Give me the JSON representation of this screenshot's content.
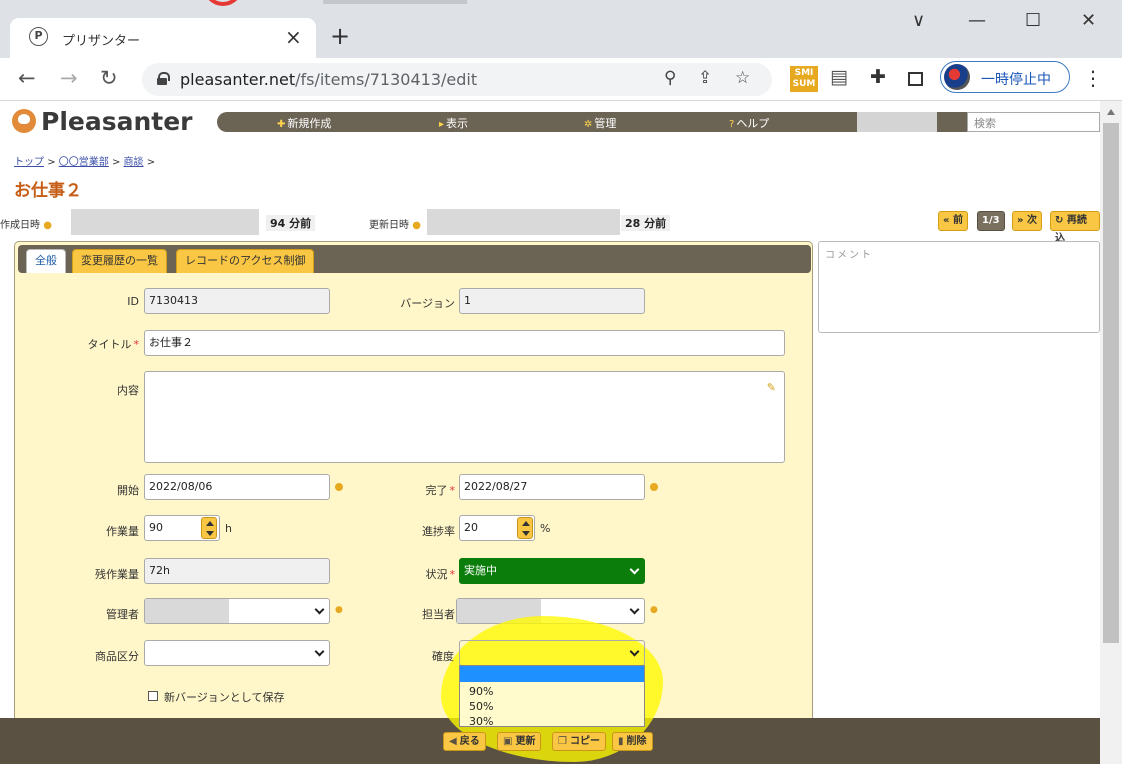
{
  "browser": {
    "tab_title": "プリザンター",
    "tab_favicon": "P",
    "url_host": "pleasanter.net",
    "url_path": "/fs/items/7130413/edit",
    "profile_label": "一時停止中",
    "ext_smi": "SMI\nSUM"
  },
  "app": {
    "logo": "Pleasanter",
    "menu": {
      "new": "新規作成",
      "view": "表示",
      "manage": "管理",
      "help": "ヘルプ"
    },
    "search_placeholder": "検索"
  },
  "breadcrumb": {
    "top": "トップ",
    "dept": "〇〇営業部",
    "category": "商談",
    "sep": ">"
  },
  "record": {
    "title": "お仕事２",
    "created_label": "作成日時",
    "created_ago": "94 分前",
    "updated_label": "更新日時",
    "updated_ago": "28 分前"
  },
  "pager": {
    "prev": "前",
    "position": "1/3",
    "next": "次",
    "reload": "再読込"
  },
  "tabs": [
    "全般",
    "変更履歴の一覧",
    "レコードのアクセス制御"
  ],
  "fields": {
    "id": {
      "label": "ID",
      "value": "7130413"
    },
    "version": {
      "label": "バージョン",
      "value": "1"
    },
    "title": {
      "label": "タイトル",
      "value": "お仕事２"
    },
    "body": {
      "label": "内容",
      "value": ""
    },
    "start": {
      "label": "開始",
      "value": "2022/08/06"
    },
    "complete": {
      "label": "完了",
      "value": "2022/08/27"
    },
    "work": {
      "label": "作業量",
      "value": "90",
      "unit": "h"
    },
    "progress": {
      "label": "進捗率",
      "value": "20",
      "unit": "%"
    },
    "remaining": {
      "label": "残作業量",
      "value": "72h"
    },
    "status": {
      "label": "状況",
      "value": "実施中"
    },
    "manager": {
      "label": "管理者",
      "value": ""
    },
    "owner": {
      "label": "担当者",
      "value": ""
    },
    "product": {
      "label": "商品区分",
      "value": ""
    },
    "certainty": {
      "label": "確度",
      "value": "",
      "options": [
        "",
        "90%",
        "50%",
        "30%"
      ]
    }
  },
  "save_new_version": "新バージョンとして保存",
  "actions": {
    "back": "戻る",
    "update": "更新",
    "copy": "コピー",
    "delete": "削除"
  },
  "comment_placeholder": "コメント",
  "colors": {
    "accent": "#f9c743",
    "status_green": "#0b7d0b",
    "title_orange": "#c65d16",
    "highlight": "#fff700",
    "selection": "#1e90ff"
  }
}
